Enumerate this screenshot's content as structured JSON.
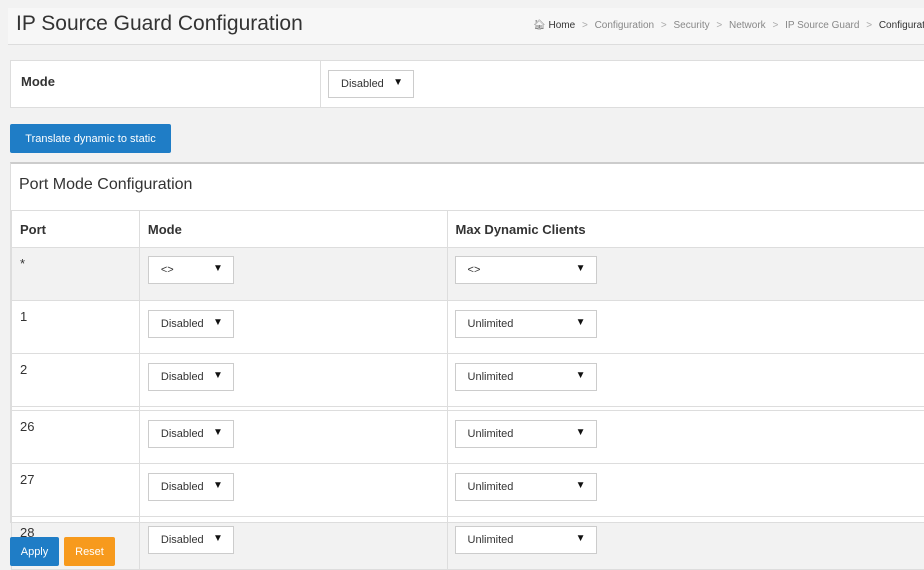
{
  "header": {
    "title": "IP Source Guard Configuration",
    "breadcrumb": [
      "Home",
      "Configuration",
      "Security",
      "Network",
      "IP Source Guard",
      "Configuration"
    ]
  },
  "global": {
    "mode_label": "Mode",
    "mode_value": "Disabled"
  },
  "actions": {
    "translate_label": "Translate dynamic to static",
    "apply_label": "Apply",
    "reset_label": "Reset"
  },
  "port_config": {
    "title": "Port Mode Configuration",
    "columns": [
      "Port",
      "Mode",
      "Max Dynamic Clients"
    ],
    "wildcard": {
      "port": "*",
      "mode": "<>",
      "max": "<>"
    },
    "rows": [
      {
        "port": "1",
        "mode": "Disabled",
        "max": "Unlimited"
      },
      {
        "port": "2",
        "mode": "Disabled",
        "max": "Unlimited"
      },
      {
        "port": "26",
        "mode": "Disabled",
        "max": "Unlimited"
      },
      {
        "port": "27",
        "mode": "Disabled",
        "max": "Unlimited"
      },
      {
        "port": "28",
        "mode": "Disabled",
        "max": "Unlimited"
      }
    ]
  },
  "colors": {
    "primary_button": "#1f7dc6",
    "reset_button": "#f79a1d"
  }
}
